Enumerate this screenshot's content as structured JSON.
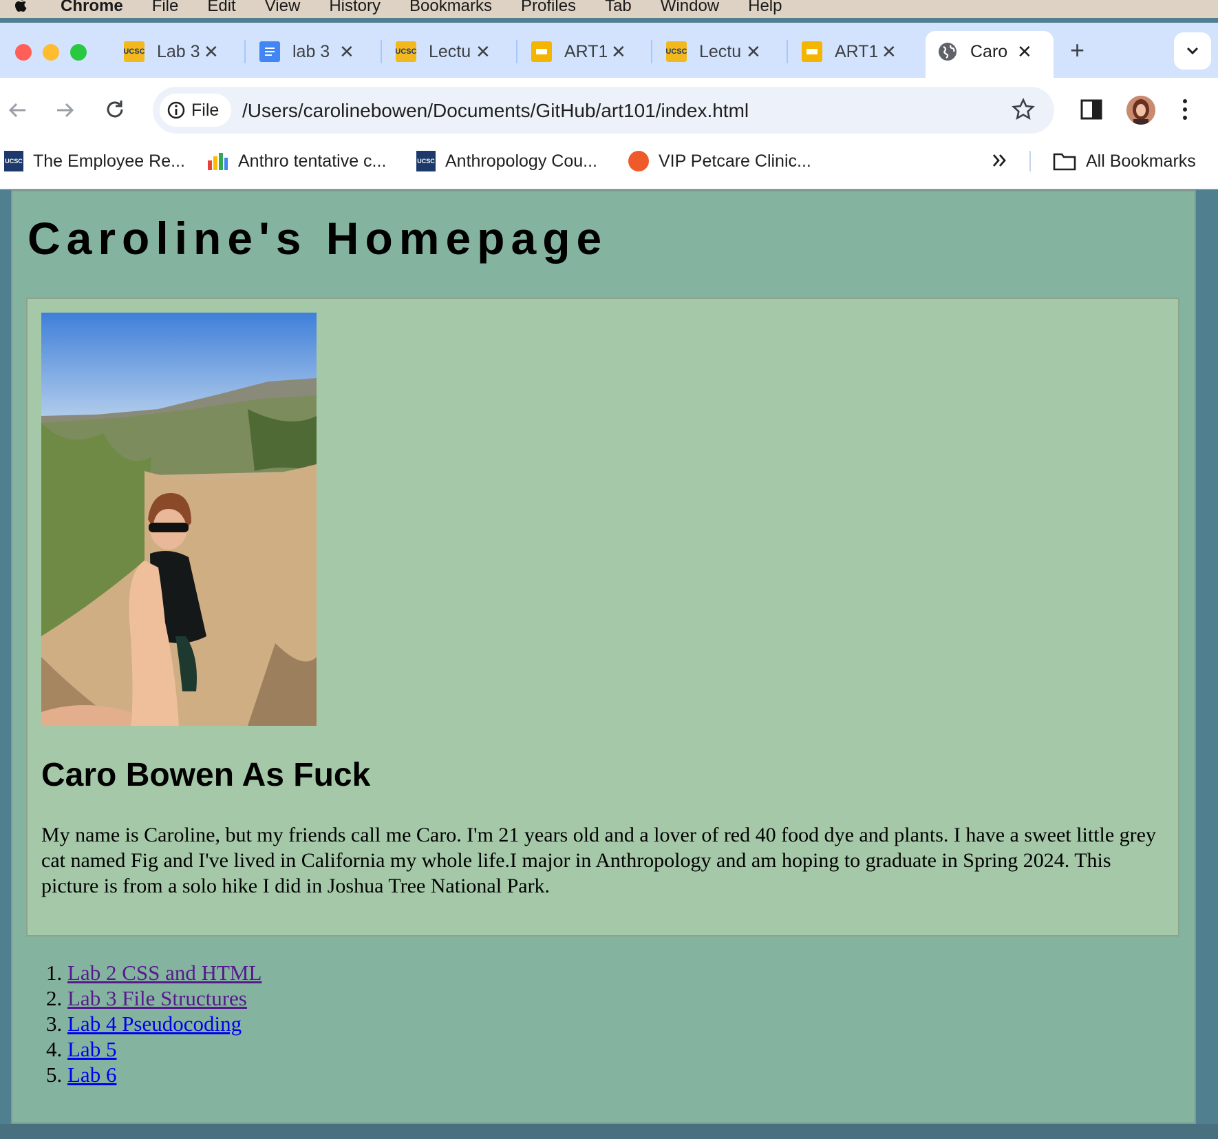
{
  "menubar": {
    "app": "Chrome",
    "items": [
      "File",
      "Edit",
      "View",
      "History",
      "Bookmarks",
      "Profiles",
      "Tab",
      "Window",
      "Help"
    ]
  },
  "tabs": [
    {
      "label": "Lab 3",
      "icon": "ucsc-icon"
    },
    {
      "label": "lab 3",
      "icon": "docs-icon"
    },
    {
      "label": "Lectu",
      "icon": "ucsc-icon"
    },
    {
      "label": "ART1",
      "icon": "slides-icon"
    },
    {
      "label": "Lectu",
      "icon": "ucsc-icon"
    },
    {
      "label": "ART1",
      "icon": "slides-icon"
    },
    {
      "label": "Caro",
      "icon": "globe-icon",
      "active": true
    }
  ],
  "address": {
    "chip": "File",
    "url": "/Users/carolinebowen/Documents/GitHub/art101/index.html"
  },
  "bookmarks": [
    {
      "label": "The Employee Re...",
      "icon": "ucsc-icon"
    },
    {
      "label": "Anthro tentative c...",
      "icon": "colorful-icon"
    },
    {
      "label": "Anthropology Cou...",
      "icon": "ucsc-icon"
    },
    {
      "label": "VIP Petcare Clinic...",
      "icon": "petcare-icon"
    }
  ],
  "bookmarks_all": "All Bookmarks",
  "page": {
    "title": "Caroline's Homepage",
    "heading": "Caro Bowen As Fuck",
    "bio": "My name is Caroline, but my friends call me Caro. I'm 21 years old and a lover of red 40 food dye and plants. I have a sweet little grey cat named Fig and I've lived in California my whole life.I major in Anthropology and am hoping to graduate in Spring 2024. This picture is from a solo hike I did in Joshua Tree National Park.",
    "labs": [
      {
        "label": "Lab 2 CSS and HTML",
        "visited": true
      },
      {
        "label": "Lab 3 File Structures",
        "visited": true
      },
      {
        "label": "Lab 4 Pseudocoding",
        "visited": false
      },
      {
        "label": "Lab 5",
        "visited": false
      },
      {
        "label": "Lab 6",
        "visited": false
      }
    ]
  },
  "colors": {
    "page_bg": "#84b4a0",
    "card_bg": "#a5c9a8",
    "visited_link": "#551a8b",
    "unvisited_link": "#0000ee",
    "tabstrip": "#d3e3fd"
  }
}
